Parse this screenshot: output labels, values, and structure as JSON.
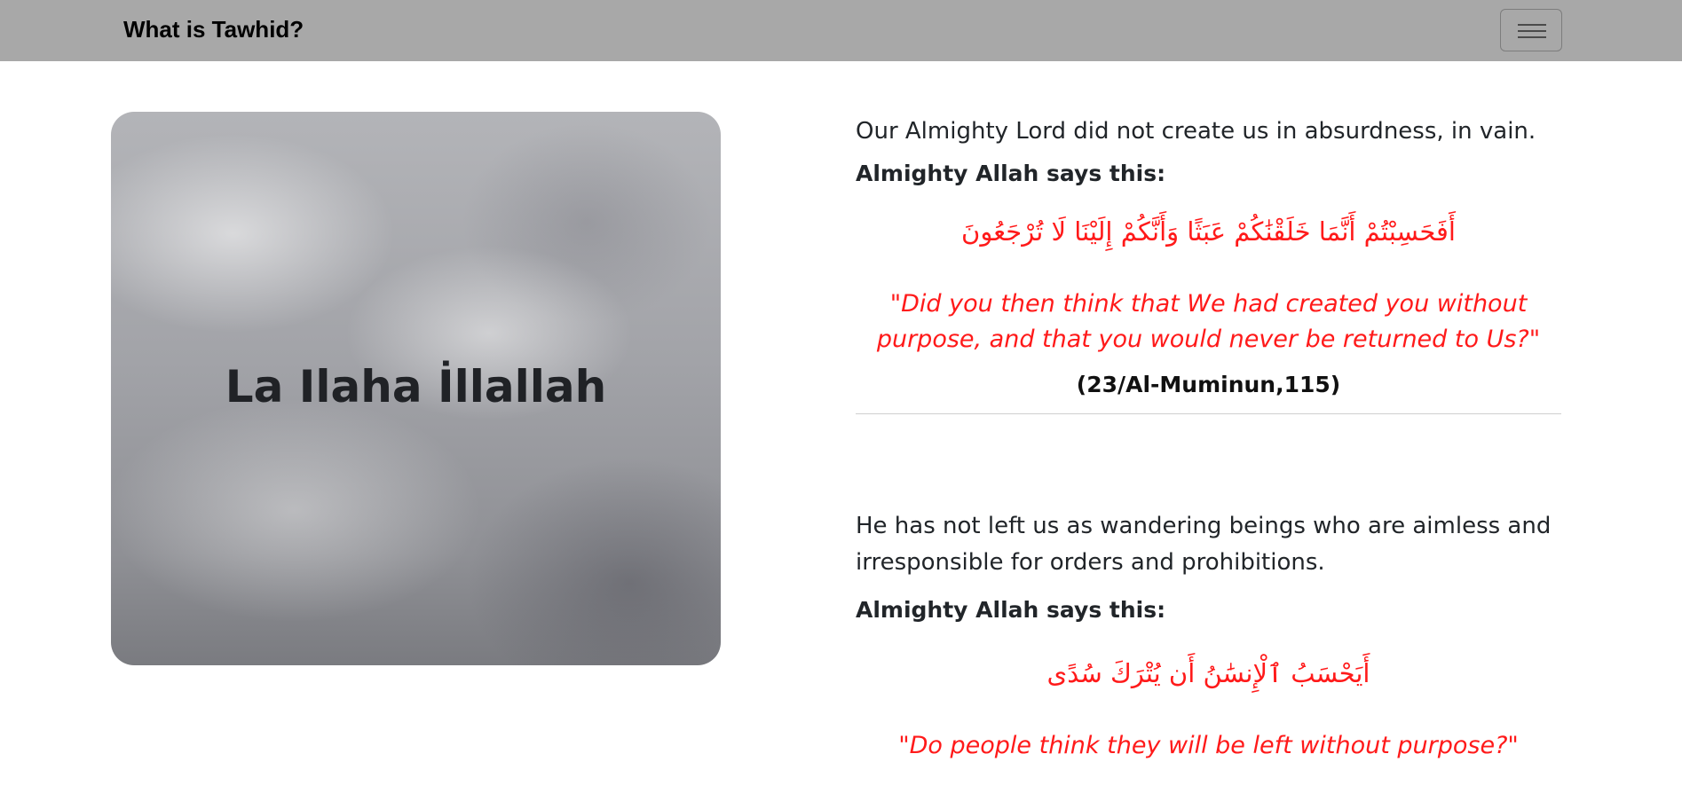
{
  "navbar": {
    "brand": "What is Tawhid?",
    "toggler_icon": "hamburger-menu-icon"
  },
  "hero": {
    "text": "La Ilaha İllallah"
  },
  "sections": [
    {
      "paragraph": "Our Almighty Lord did not create us in absurdness, in vain.",
      "says": "Almighty Allah says this:",
      "arabic": "أَفَحَسِبْتُمْ أَنَّمَا خَلَقْنَٰكُمْ عَبَثًا وَأَنَّكُمْ إِلَيْنَا لَا تُرْجَعُونَ",
      "translation": "\"Did you then think that We had created you without purpose, and that you would never be returned to Us?\"",
      "reference": "(23/Al-Muminun,115)"
    },
    {
      "paragraph": "He has not left us as wandering beings who are aimless and irresponsible for orders and prohibitions.",
      "says": "Almighty Allah says this:",
      "arabic": "أَيَحْسَبُ ٱلْإِنسَٰنُ أَن يُتْرَكَ سُدًى",
      "translation": "\"Do people think they will be left without purpose?\""
    }
  ],
  "colors": {
    "navbar_bg": "#a8a8a8",
    "quote_red": "#ff1a1a",
    "text_dark": "#212529"
  }
}
